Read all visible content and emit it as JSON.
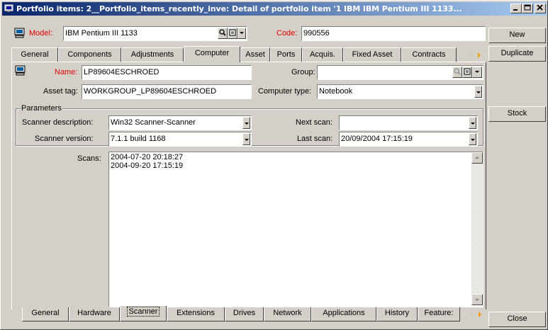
{
  "window": {
    "title": "Portfolio items: 2__Portfolio_items_recently_inve: Detail of portfolio item '1 IBM IBM Pentium III 1133..."
  },
  "header": {
    "model_label": "Model:",
    "model_value": "IBM Pentium III 1133",
    "code_label": "Code:",
    "code_value": "990556"
  },
  "top_tabs": [
    {
      "label": "General"
    },
    {
      "label": "Components"
    },
    {
      "label": "Adjustments"
    },
    {
      "label": "Computer"
    },
    {
      "label": "Asset"
    },
    {
      "label": "Ports"
    },
    {
      "label": "Acquis."
    },
    {
      "label": "Fixed Asset"
    },
    {
      "label": "Contracts"
    }
  ],
  "computer": {
    "name_label": "Name:",
    "name_value": "LP89604ESCHROED",
    "group_label": "Group:",
    "group_value": "",
    "asset_tag_label": "Asset tag:",
    "asset_tag_value": "WORKGROUP_LP89604ESCHROED",
    "computer_type_label": "Computer type:",
    "computer_type_value": "Notebook"
  },
  "parameters": {
    "legend": "Parameters",
    "scanner_description_label": "Scanner description:",
    "scanner_description_value": "Win32 Scanner-Scanner",
    "next_scan_label": "Next scan:",
    "next_scan_value": "",
    "scanner_version_label": "Scanner version:",
    "scanner_version_value": "7.1.1 build 1168",
    "last_scan_label": "Last scan:",
    "last_scan_value": "20/09/2004 17:15:19"
  },
  "scans": {
    "label": "Scans:",
    "entries": [
      "2004-07-20 20:18:27",
      "2004-09-20 17:15:19"
    ]
  },
  "bottom_tabs": [
    {
      "label": "General"
    },
    {
      "label": "Hardware"
    },
    {
      "label": "Scanner"
    },
    {
      "label": "Extensions"
    },
    {
      "label": "Drives"
    },
    {
      "label": "Network"
    },
    {
      "label": "Applications"
    },
    {
      "label": "History"
    },
    {
      "label": "Feature:"
    }
  ],
  "side_buttons": {
    "new": "New",
    "duplicate": "Duplicate",
    "stock": "Stock",
    "close": "Close"
  },
  "colors": {
    "title_start": "#0a246a",
    "title_end": "#a6caf0",
    "required_label": "#e00000",
    "nav_arrow": "#f0a000"
  }
}
